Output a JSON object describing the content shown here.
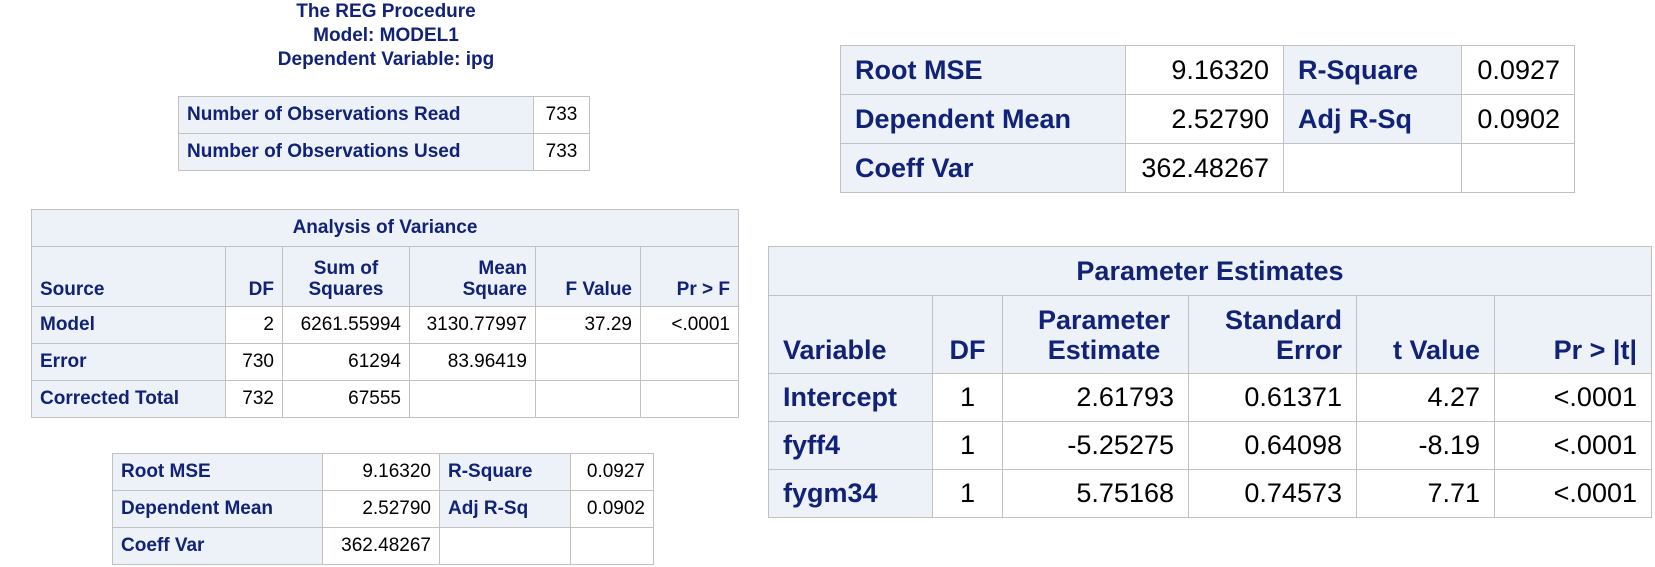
{
  "header": {
    "line1": "The REG Procedure",
    "line2": "Model: MODEL1",
    "line3": "Dependent Variable: ipg"
  },
  "observations": {
    "rows": [
      {
        "label": "Number of Observations Read",
        "value": "733"
      },
      {
        "label": "Number of Observations Used",
        "value": "733"
      }
    ]
  },
  "anova": {
    "caption": "Analysis of Variance",
    "columns": [
      "Source",
      "DF",
      "Sum of Squares",
      "Mean Square",
      "F Value",
      "Pr > F"
    ],
    "rows": [
      {
        "source": "Model",
        "df": "2",
        "ss": "6261.55994",
        "ms": "3130.77997",
        "f": "37.29",
        "p": "<.0001"
      },
      {
        "source": "Error",
        "df": "730",
        "ss": "61294",
        "ms": "83.96419",
        "f": "",
        "p": ""
      },
      {
        "source": "Corrected Total",
        "df": "732",
        "ss": "67555",
        "ms": "",
        "f": "",
        "p": ""
      }
    ]
  },
  "fit": {
    "root_mse_label": "Root MSE",
    "root_mse": "9.16320",
    "rsq_label": "R-Square",
    "rsq": "0.0927",
    "dep_mean_label": "Dependent Mean",
    "dep_mean": "2.52790",
    "adj_rsq_label": "Adj R-Sq",
    "adj_rsq": "0.0902",
    "coeff_var_label": "Coeff Var",
    "coeff_var": "362.48267"
  },
  "params": {
    "caption": "Parameter Estimates",
    "columns": [
      "Variable",
      "DF",
      "Parameter Estimate",
      "Standard Error",
      "t Value",
      "Pr > |t|"
    ],
    "rows": [
      {
        "variable": "Intercept",
        "df": "1",
        "est": "2.61793",
        "se": "0.61371",
        "t": "4.27",
        "p": "<.0001"
      },
      {
        "variable": "fyff4",
        "df": "1",
        "est": "-5.25275",
        "se": "0.64098",
        "t": "-8.19",
        "p": "<.0001"
      },
      {
        "variable": "fygm34",
        "df": "1",
        "est": "5.75168",
        "se": "0.74573",
        "t": "7.71",
        "p": "<.0001"
      }
    ]
  }
}
